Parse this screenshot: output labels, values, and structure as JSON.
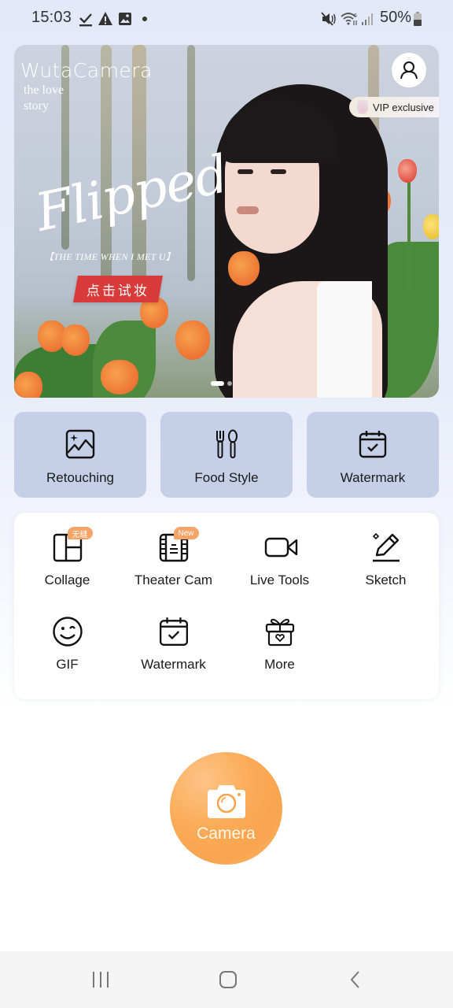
{
  "status_bar": {
    "time": "15:03",
    "left_icons": [
      "download-done-icon",
      "warning-icon",
      "image-icon",
      "dot-icon"
    ],
    "right_icons": [
      "mute-icon",
      "wifi-icon",
      "signal-icon"
    ],
    "battery_percent": "50%"
  },
  "banner": {
    "brand": "WutaCamera",
    "tagline": "the love story",
    "title": "Flipped",
    "subtitle": "【THE TIME WHEN I MET U】",
    "cta_label": "点击试妆",
    "vip_label": "VIP exclusive",
    "profile_icon": "user-icon",
    "pager": {
      "pages": 2,
      "active_index": 0
    }
  },
  "features": [
    {
      "label": "Retouching",
      "icon": "image-sparkle-icon"
    },
    {
      "label": "Food Style",
      "icon": "fork-spoon-icon"
    },
    {
      "label": "Watermark",
      "icon": "calendar-check-icon"
    }
  ],
  "tools": [
    {
      "label": "Collage",
      "icon": "collage-icon",
      "badge": "无缝"
    },
    {
      "label": "Theater Cam",
      "icon": "film-icon",
      "badge": "New"
    },
    {
      "label": "Live Tools",
      "icon": "video-camera-icon",
      "badge": null
    },
    {
      "label": "Sketch",
      "icon": "pencil-icon",
      "badge": null
    },
    {
      "label": "GIF",
      "icon": "wink-face-icon",
      "badge": null
    },
    {
      "label": "Watermark",
      "icon": "calendar-check-icon",
      "badge": null
    },
    {
      "label": "More",
      "icon": "gift-icon",
      "badge": null
    }
  ],
  "camera_button": {
    "label": "Camera",
    "icon": "camera-icon"
  },
  "nav_bar": {
    "buttons": [
      "recent-apps",
      "home",
      "back"
    ]
  },
  "colors": {
    "feature_card_bg": "#c5d0e8",
    "camera_orange": "#f9a44e",
    "badge_orange": "#f3a466",
    "cta_red": "#d93b3a"
  }
}
